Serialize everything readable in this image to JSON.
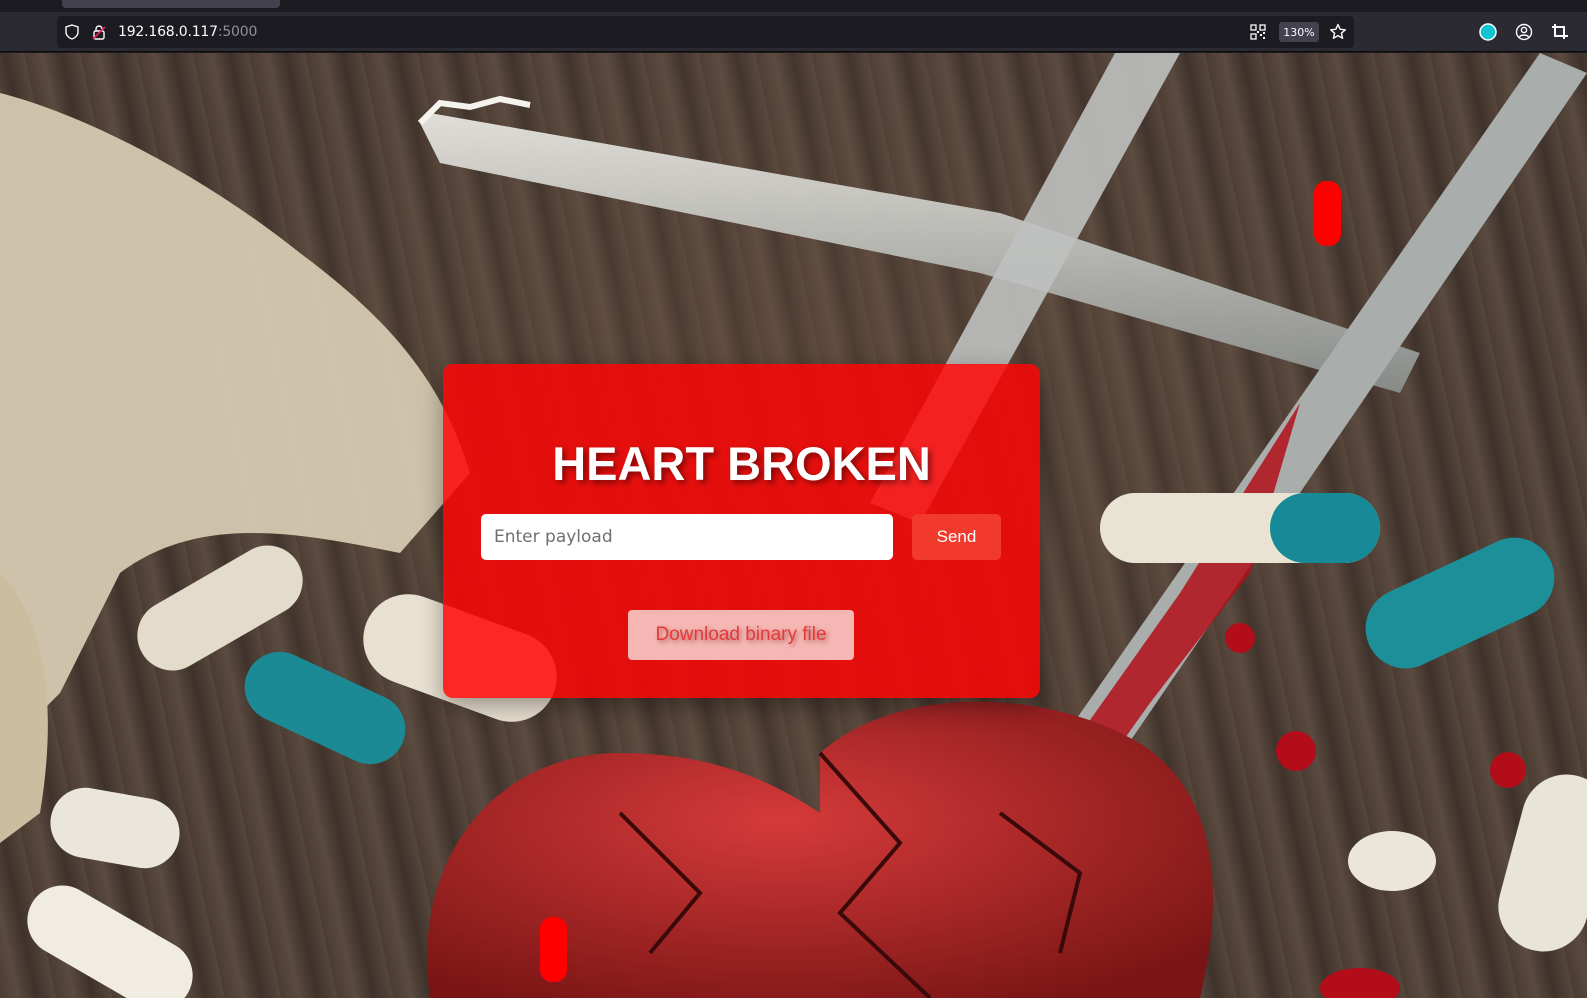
{
  "browser": {
    "url_host": "192.168.0.117",
    "url_port": ":5000",
    "zoom_level": "130%",
    "icons": [
      "shield-icon",
      "lock-warning-icon",
      "qr-code-icon",
      "bookmark-star-icon",
      "extension-icon",
      "account-icon",
      "screenshot-icon"
    ]
  },
  "card": {
    "title": "HEART BROKEN",
    "payload_placeholder": "Enter payload",
    "payload_value": "",
    "send_label": "Send",
    "download_label": "Download binary file"
  },
  "colors": {
    "card_background": "#ff0505",
    "send_button": "#f23a2c",
    "download_button": "#f5b7b3",
    "download_text": "#e53a3a",
    "blood_drop": "#ff0000"
  }
}
